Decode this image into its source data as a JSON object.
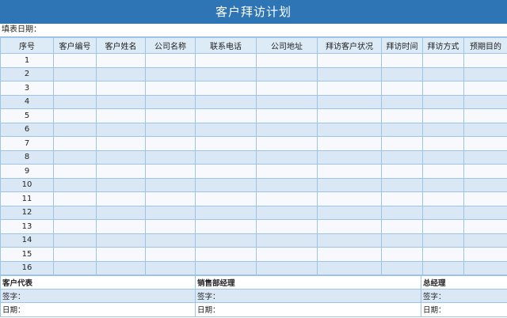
{
  "title": "客户拜访计划",
  "fill_date_label": "填表日期：",
  "columns": [
    "序号",
    "客户编号",
    "客户姓名",
    "公司名称",
    "联系电话",
    "公司地址",
    "拜访客户状况",
    "拜访时间",
    "拜访方式",
    "预期目的"
  ],
  "rows": [
    "1",
    "2",
    "3",
    "4",
    "5",
    "6",
    "7",
    "8",
    "9",
    "10",
    "11",
    "12",
    "13",
    "14",
    "15",
    "16"
  ],
  "footer": {
    "roles": [
      "客户代表",
      "销售部经理",
      "总经理"
    ],
    "sign_label": "签字：",
    "date_label": "日期："
  }
}
